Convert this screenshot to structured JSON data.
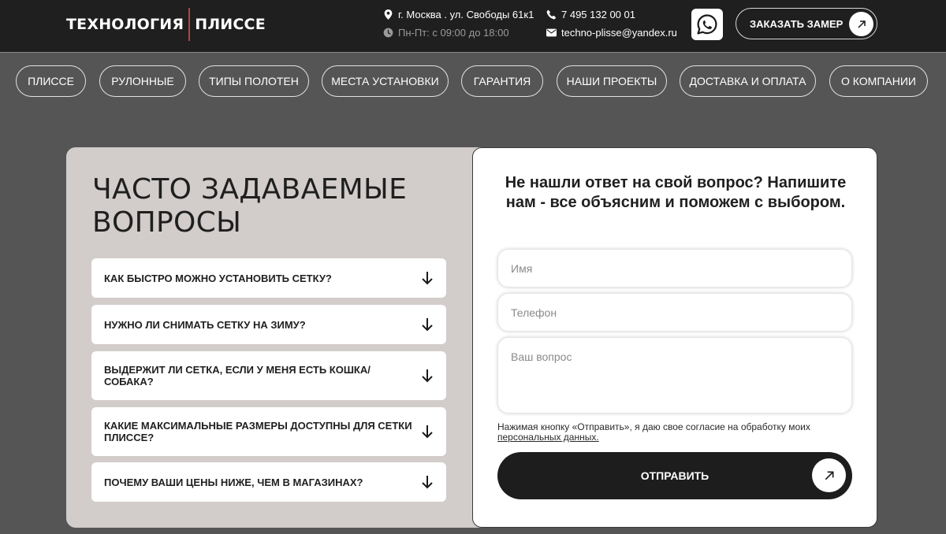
{
  "header": {
    "logo_left": "ТЕХНОЛОГИЯ",
    "logo_right": "ПЛИССЕ",
    "address": "г. Москва . ул. Свободы 61к1",
    "hours": "Пн-Пт: с 09:00 до 18:00",
    "phone": "7 495 132 00 01",
    "email": "techno-plisse@yandex.ru",
    "whatsapp_icon": "whatsapp-icon",
    "order_label": "ЗАКАЗАТЬ ЗАМЕР"
  },
  "nav": {
    "items": [
      {
        "label": "ПЛИССЕ"
      },
      {
        "label": "РУЛОННЫЕ"
      },
      {
        "label": "ТИПЫ ПОЛОТЕН"
      },
      {
        "label": "МЕСТА УСТАНОВКИ"
      },
      {
        "label": "ГАРАНТИЯ"
      },
      {
        "label": "НАШИ ПРОЕКТЫ"
      },
      {
        "label": "ДОСТАВКА И ОПЛАТА"
      },
      {
        "label": "О КОМПАНИИ"
      }
    ]
  },
  "faq": {
    "title": "ЧАСТО ЗАДАВАЕМЫЕ ВОПРОСЫ",
    "items": [
      {
        "question": "КАК БЫСТРО МОЖНО УСТАНОВИТЬ СЕТКУ?"
      },
      {
        "question": "НУЖНО ЛИ СНИМАТЬ СЕТКУ НА ЗИМУ?"
      },
      {
        "question": "ВЫДЕРЖИТ ЛИ СЕТКА, ЕСЛИ У МЕНЯ ЕСТЬ КОШКА/ СОБАКА?"
      },
      {
        "question": "КАКИЕ МАКСИМАЛЬНЫЕ РАЗМЕРЫ ДОСТУПНЫ ДЛЯ СЕТКИ ПЛИССЕ?"
      },
      {
        "question": "ПОЧЕМУ ВАШИ ЦЕНЫ НИЖЕ, ЧЕМ В МАГАЗИНАХ?"
      }
    ]
  },
  "form": {
    "title": "Не нашли ответ на свой вопрос? Напишите нам - все объясним и поможем с выбором.",
    "name_placeholder": "Имя",
    "phone_placeholder": "Телефон",
    "question_placeholder": "Ваш вопрос",
    "consent_text": "Нажимая кнопку «Отправить», я даю свое согласие на обработку моих",
    "consent_link": "персональных данных.",
    "submit_label": "ОТПРАВИТЬ"
  },
  "colors": {
    "background": "#555555",
    "header_bg": "#1f1f1f",
    "logo_separator": "#b5463a",
    "faq_panel_bg": "#d2cccb",
    "button_dark": "#1d1d1d"
  }
}
